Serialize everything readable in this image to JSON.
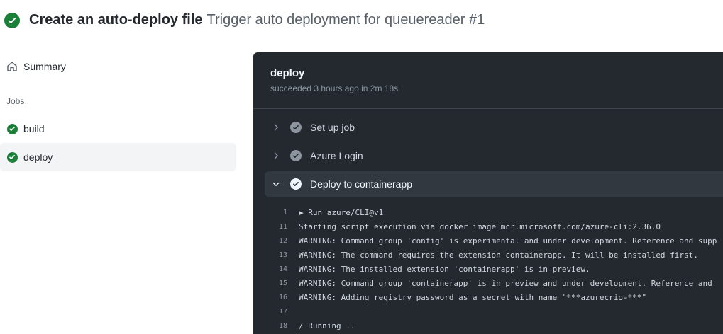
{
  "header": {
    "title": "Create an auto-deploy file",
    "subtitle": "Trigger auto deployment for queuereader #1"
  },
  "sidebar": {
    "summary_label": "Summary",
    "jobs_heading": "Jobs",
    "jobs": [
      {
        "label": "build",
        "status": "success"
      },
      {
        "label": "deploy",
        "status": "success",
        "active": true
      }
    ]
  },
  "job": {
    "name": "deploy",
    "status_text": "succeeded 3 hours ago in 2m 18s",
    "steps": [
      {
        "label": "Set up job",
        "expanded": false
      },
      {
        "label": "Azure Login",
        "expanded": false
      },
      {
        "label": "Deploy to containerapp",
        "expanded": true
      }
    ],
    "log": [
      {
        "num": "1",
        "text": "▶ Run azure/CLI@v1"
      },
      {
        "num": "11",
        "text": "Starting script execution via docker image mcr.microsoft.com/azure-cli:2.36.0"
      },
      {
        "num": "12",
        "text": "WARNING: Command group 'config' is experimental and under development. Reference and supp"
      },
      {
        "num": "13",
        "text": "WARNING: The command requires the extension containerapp. It will be installed first."
      },
      {
        "num": "14",
        "text": "WARNING: The installed extension 'containerapp' is in preview."
      },
      {
        "num": "15",
        "text": "WARNING: Command group 'containerapp' is in preview and under development. Reference and"
      },
      {
        "num": "16",
        "text": "WARNING: Adding registry password as a secret with name \"***azurecrio-***\""
      },
      {
        "num": "17",
        "text": ""
      },
      {
        "num": "18",
        "text": "/ Running .."
      }
    ]
  },
  "colors": {
    "success": "#1a7f37",
    "panel_bg": "#24292f",
    "expanded_step_bg": "#32383f"
  }
}
